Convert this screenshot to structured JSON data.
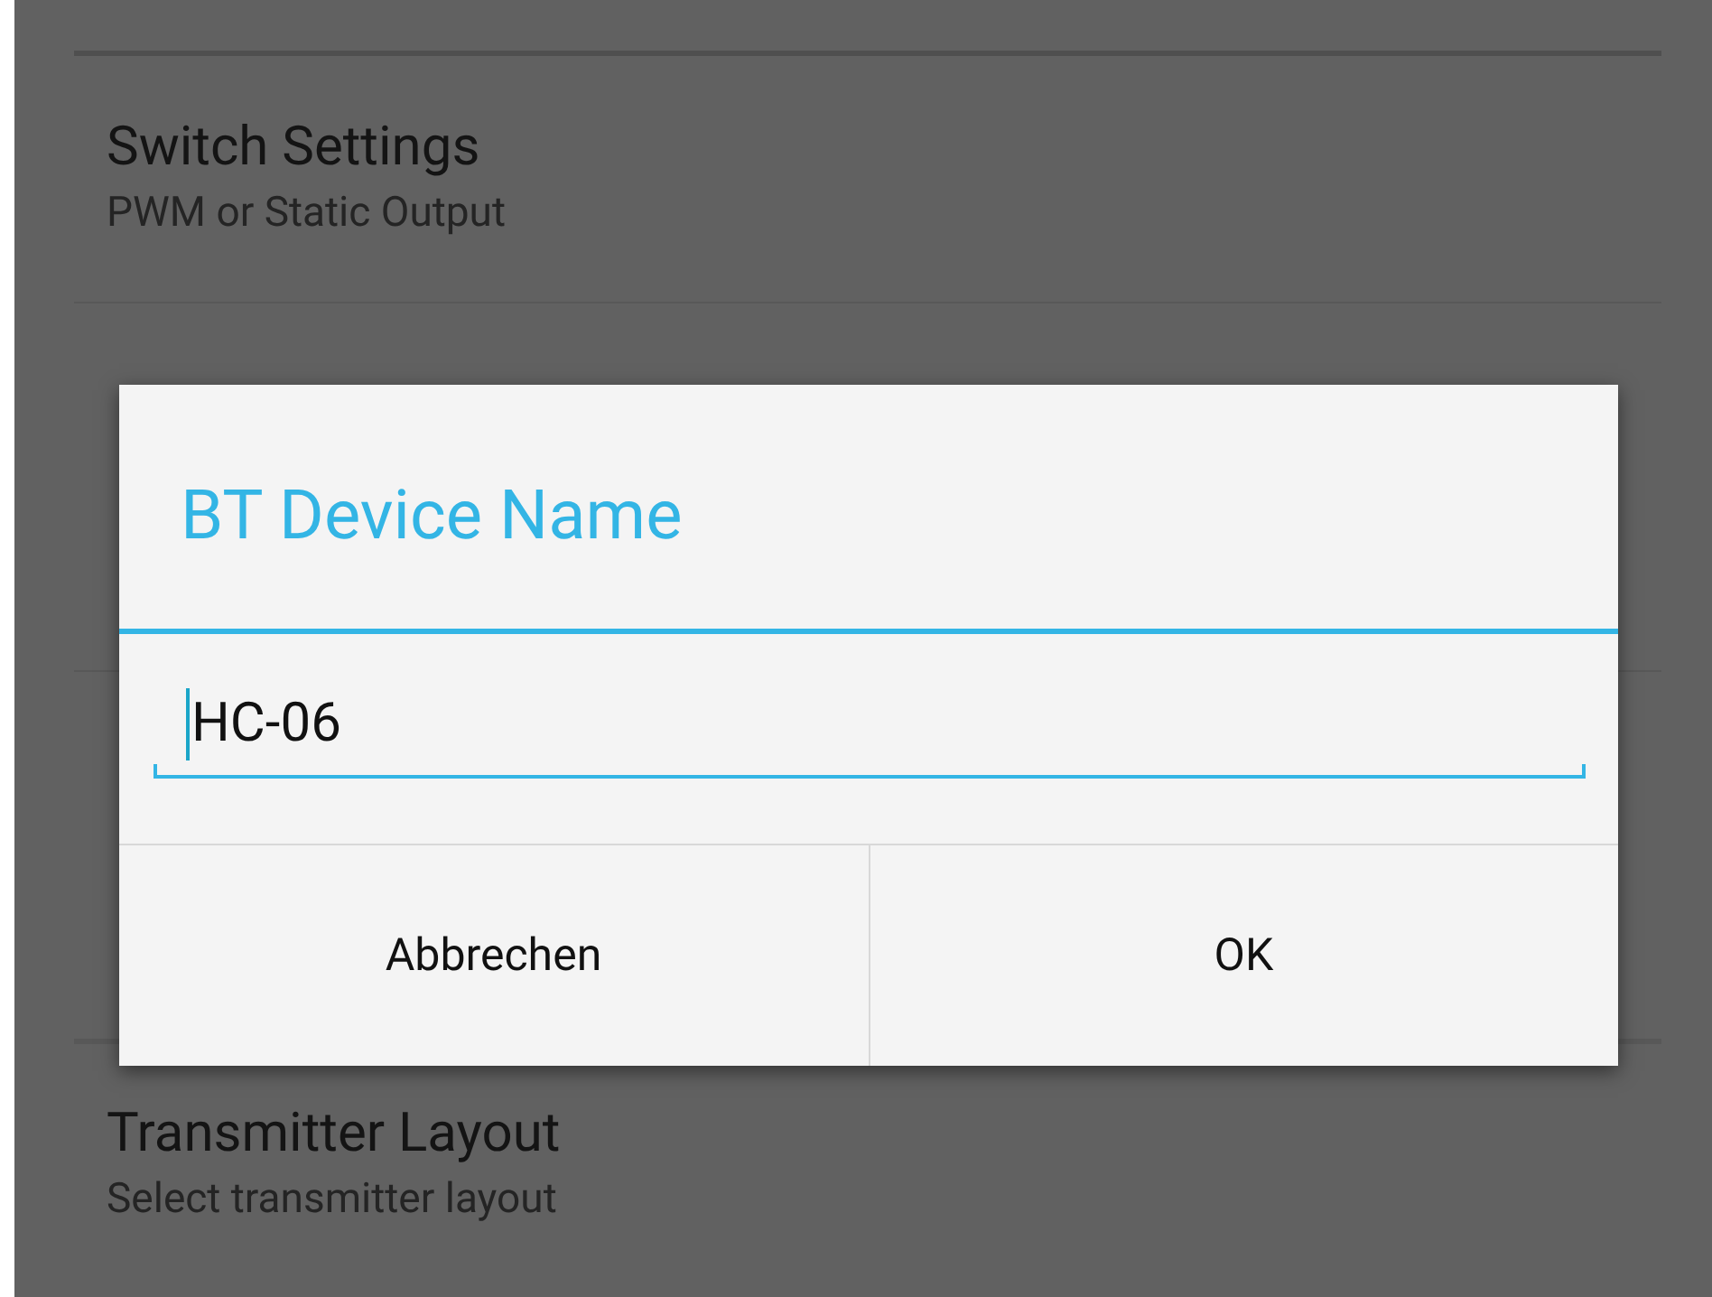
{
  "settings": {
    "items": [
      {
        "title": "Switch Settings",
        "summary": "PWM or Static Output"
      }
    ],
    "bottom_items": [
      {
        "title": "Transmitter Layout",
        "summary": "Select transmitter layout"
      }
    ]
  },
  "dialog": {
    "title": "BT Device Name",
    "field": {
      "value": "HC-06"
    },
    "buttons": [
      "Abbrechen",
      "OK"
    ]
  }
}
